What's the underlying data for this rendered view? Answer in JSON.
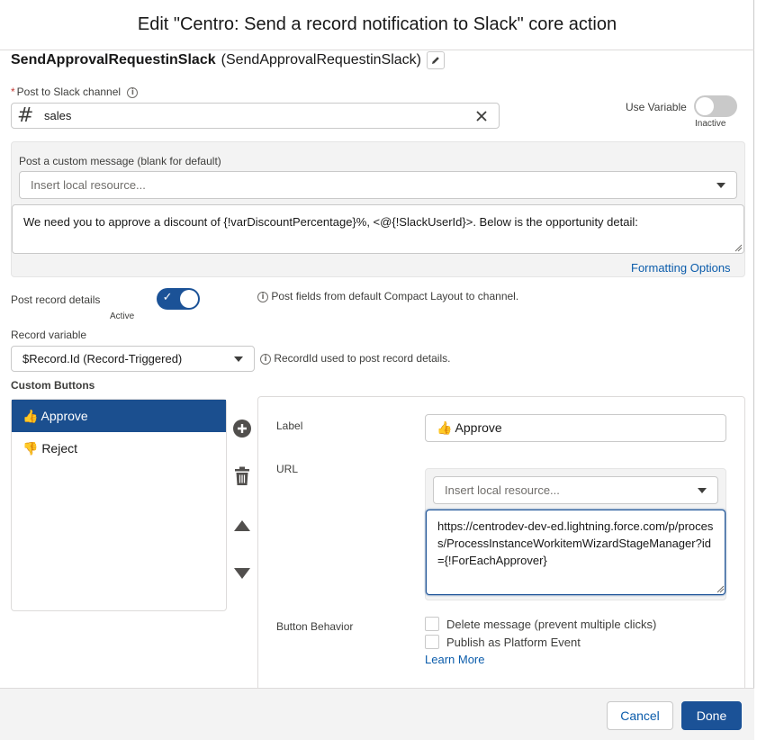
{
  "modal": {
    "title": "Edit \"Centro: Send a record notification to Slack\" core action"
  },
  "action": {
    "name": "SendApprovalRequestinSlack",
    "api_name": "(SendApprovalRequestinSlack)"
  },
  "channel": {
    "label": "Post to Slack channel",
    "required_mark": "*",
    "value": "sales",
    "prefix_glyph": "#"
  },
  "use_variable": {
    "label": "Use Variable",
    "state_label": "Inactive"
  },
  "custom_message": {
    "label": "Post a custom message (blank for default)",
    "resource_placeholder": "Insert local resource...",
    "message": "We need you to approve a discount of {!varDiscountPercentage}%, <@{!SlackUserId}>. Below is the opportunity detail:",
    "formatting_link": "Formatting Options"
  },
  "record_details": {
    "label": "Post record details",
    "state_label": "Active",
    "help": "Post fields from default Compact Layout to channel."
  },
  "record_variable": {
    "label": "Record variable",
    "value": "$Record.Id (Record-Triggered)",
    "help": "RecordId used to post record details."
  },
  "custom_buttons": {
    "heading": "Custom Buttons",
    "items": [
      {
        "label": "👍 Approve",
        "selected": true
      },
      {
        "label": "👎 Reject",
        "selected": false
      }
    ]
  },
  "button_editor": {
    "label_field_label": "Label",
    "label_value": "👍 Approve",
    "url_label": "URL",
    "url_resource_placeholder": "Insert local resource...",
    "url_value": "https://centrodev-dev-ed.lightning.force.com/p/process/ProcessInstanceWorkitemWizardStageManager?id={!ForEachApprover}",
    "behavior_label": "Button Behavior",
    "behavior_options": [
      "Delete message (prevent multiple clicks)",
      "Publish as Platform Event"
    ],
    "learn_more": "Learn More"
  },
  "footer": {
    "cancel": "Cancel",
    "done": "Done"
  },
  "colors": {
    "brand": "#1b5297",
    "link": "#0b5cab",
    "toggle_off": "#c9c9c9",
    "required": "#c23934"
  }
}
